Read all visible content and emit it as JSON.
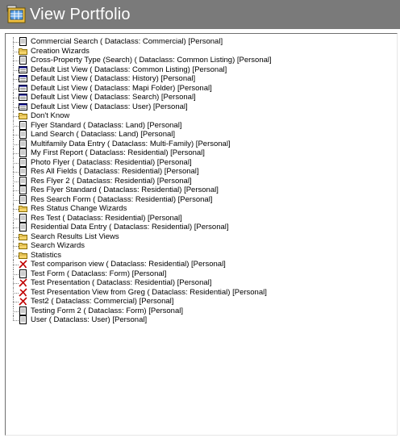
{
  "window": {
    "title": "View Portfolio",
    "title_icon": "portfolio-icon"
  },
  "colors": {
    "titlebar": "#7a7a7a",
    "folder": "#f5d46a",
    "delete_x": "#c00000"
  },
  "tree": {
    "items": [
      {
        "label": "Commercial Search ( Dataclass: Commercial) [Personal]",
        "icon": "document-icon"
      },
      {
        "label": "Creation Wizards",
        "icon": "folder-icon"
      },
      {
        "label": "Cross-Property Type (Search) ( Dataclass: Common Listing) [Personal]",
        "icon": "document-icon"
      },
      {
        "label": "Default List View ( Dataclass: Common Listing) [Personal]",
        "icon": "list-view-icon"
      },
      {
        "label": "Default List View ( Dataclass: History) [Personal]",
        "icon": "list-view-icon"
      },
      {
        "label": "Default List View ( Dataclass: Mapi Folder) [Personal]",
        "icon": "list-view-icon"
      },
      {
        "label": "Default List View ( Dataclass: Search) [Personal]",
        "icon": "list-view-icon"
      },
      {
        "label": "Default List View ( Dataclass: User) [Personal]",
        "icon": "list-view-icon"
      },
      {
        "label": "Don't Know",
        "icon": "folder-icon"
      },
      {
        "label": "Flyer Standard ( Dataclass: Land) [Personal]",
        "icon": "document-icon"
      },
      {
        "label": "Land Search ( Dataclass: Land) [Personal]",
        "icon": "document-icon"
      },
      {
        "label": "Multifamily Data Entry ( Dataclass: Multi-Family) [Personal]",
        "icon": "document-icon"
      },
      {
        "label": "My First Report ( Dataclass: Residential) [Personal]",
        "icon": "document-icon"
      },
      {
        "label": "Photo Flyer ( Dataclass: Residential) [Personal]",
        "icon": "document-icon"
      },
      {
        "label": "Res All Fields ( Dataclass: Residential) [Personal]",
        "icon": "document-icon"
      },
      {
        "label": "Res Flyer 2 ( Dataclass: Residential) [Personal]",
        "icon": "document-icon"
      },
      {
        "label": "Res Flyer Standard ( Dataclass: Residential) [Personal]",
        "icon": "document-icon"
      },
      {
        "label": "Res Search Form ( Dataclass: Residential) [Personal]",
        "icon": "document-icon"
      },
      {
        "label": "Res Status Change Wizards",
        "icon": "folder-icon"
      },
      {
        "label": "Res Test ( Dataclass: Residential) [Personal]",
        "icon": "document-icon"
      },
      {
        "label": "Residential Data Entry ( Dataclass: Residential) [Personal]",
        "icon": "document-icon"
      },
      {
        "label": "Search Results List Views",
        "icon": "folder-icon"
      },
      {
        "label": "Search Wizards",
        "icon": "folder-icon"
      },
      {
        "label": "Statistics",
        "icon": "folder-icon"
      },
      {
        "label": "Test comparison view ( Dataclass: Residential) [Personal]",
        "icon": "red-x-icon"
      },
      {
        "label": "Test Form ( Dataclass: Form) [Personal]",
        "icon": "document-icon"
      },
      {
        "label": "Test Presentation ( Dataclass: Residential) [Personal]",
        "icon": "red-x-icon"
      },
      {
        "label": "Test Presentation View from Greg ( Dataclass: Residential) [Personal]",
        "icon": "red-x-icon"
      },
      {
        "label": "Test2 ( Dataclass: Commercial) [Personal]",
        "icon": "red-x-icon"
      },
      {
        "label": "Testing Form 2 ( Dataclass: Form) [Personal]",
        "icon": "document-icon"
      },
      {
        "label": "User ( Dataclass: User) [Personal]",
        "icon": "document-icon"
      }
    ]
  }
}
